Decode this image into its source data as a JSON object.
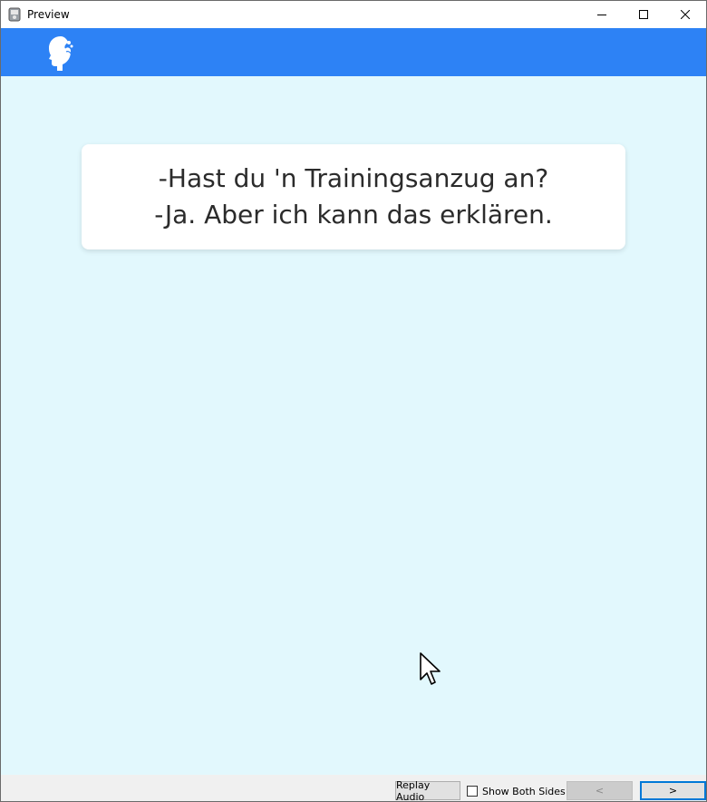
{
  "window": {
    "title": "Preview",
    "app_icon": "preview-app-icon",
    "controls": {
      "minimize_icon": "minimize-icon",
      "maximize_icon": "maximize-icon",
      "close_icon": "close-icon"
    }
  },
  "header": {
    "logo_icon": "head-silhouette-logo-icon",
    "background_color": "#2d82f5"
  },
  "content": {
    "background_color": "#e2f8fd",
    "card": {
      "line1": "-Hast du 'n Trainingsanzug an?",
      "line2": "-Ja. Aber ich kann das erklären."
    }
  },
  "footer": {
    "replay_label": "Replay Audio",
    "show_both_sides_label": "Show Both Sides",
    "show_both_sides_checked": false,
    "prev_label": "<",
    "prev_enabled": false,
    "next_label": ">",
    "next_enabled": true
  },
  "colors": {
    "accent": "#0078d7",
    "text": "#2b2b2b"
  }
}
